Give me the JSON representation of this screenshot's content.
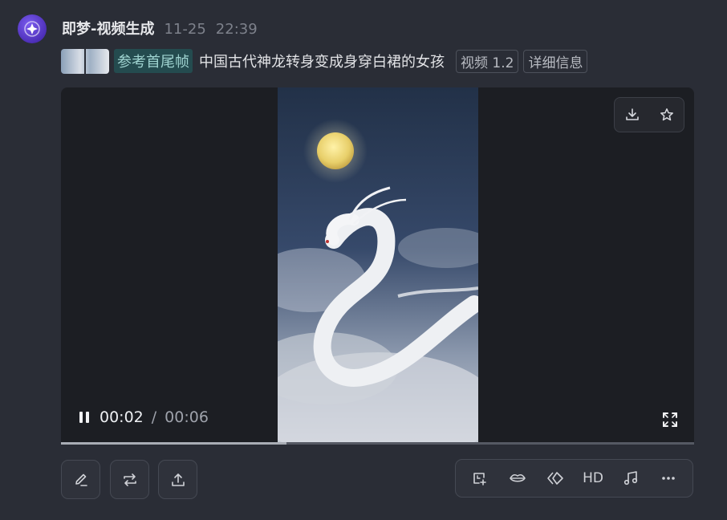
{
  "header": {
    "app_name": "即梦-视频生成",
    "date": "11-25",
    "time": "22:39"
  },
  "prompt": {
    "ref_tag": "参考首尾帧",
    "text": "中国古代神龙转身变成身穿白裙的女孩",
    "model_chip": "视频 1.2",
    "details_chip": "详细信息"
  },
  "player": {
    "current_time": "00:02",
    "separator": "/",
    "total_time": "00:06",
    "progress": 0.356,
    "state": "playing",
    "download_icon": "download-icon",
    "favorite_icon": "star-icon"
  },
  "actions": {
    "left": [
      "edit-icon",
      "regenerate-icon",
      "share-icon"
    ],
    "right_hd_label": "HD"
  },
  "colors": {
    "background": "#2a2d36",
    "accent": "#6a4ee0",
    "ref_tag_bg": "#244b4f"
  }
}
